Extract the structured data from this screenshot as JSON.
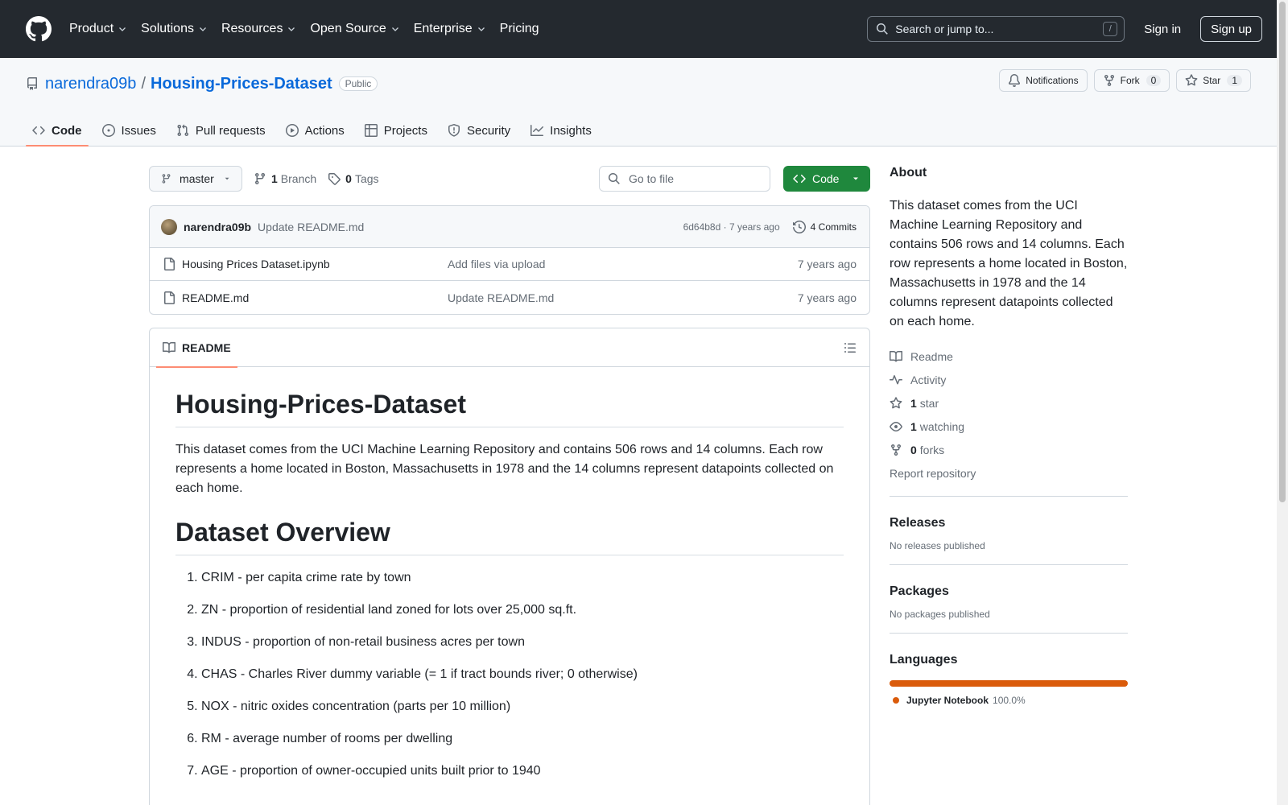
{
  "header": {
    "nav": [
      "Product",
      "Solutions",
      "Resources",
      "Open Source",
      "Enterprise",
      "Pricing"
    ],
    "search_placeholder": "Search or jump to...",
    "search_shortcut": "/",
    "sign_in": "Sign in",
    "sign_up": "Sign up"
  },
  "repo": {
    "owner": "narendra09b",
    "separator": "/",
    "name": "Housing-Prices-Dataset",
    "visibility": "Public",
    "notifications": "Notifications",
    "fork_label": "Fork",
    "fork_count": "0",
    "star_label": "Star",
    "star_count": "1",
    "tabs": [
      "Code",
      "Issues",
      "Pull requests",
      "Actions",
      "Projects",
      "Security",
      "Insights"
    ]
  },
  "filenav": {
    "branch": "master",
    "branch_count": "1",
    "branch_label": "Branch",
    "tag_count": "0",
    "tag_label": "Tags",
    "goto_placeholder": "Go to file",
    "code_button": "Code"
  },
  "commit": {
    "author": "narendra09b",
    "message": "Update README.md",
    "meta": "6d64b8d · 7 years ago",
    "count": "4 Commits"
  },
  "files": [
    {
      "name": "Housing Prices Dataset.ipynb",
      "message": "Add files via upload",
      "date": "7 years ago"
    },
    {
      "name": "README.md",
      "message": "Update README.md",
      "date": "7 years ago"
    }
  ],
  "readme": {
    "tab": "README",
    "title": "Housing-Prices-Dataset",
    "intro": "This dataset comes from the UCI Machine Learning Repository and contains 506 rows and 14 columns. Each row represents a home located in Boston, Massachusetts in 1978 and the 14 columns represent datapoints collected on each home.",
    "overview_title": "Dataset Overview",
    "items": [
      "CRIM - per capita crime rate by town",
      "ZN - proportion of residential land zoned for lots over 25,000 sq.ft.",
      "INDUS - proportion of non-retail business acres per town",
      "CHAS - Charles River dummy variable (= 1 if tract bounds river; 0 otherwise)",
      "NOX - nitric oxides concentration (parts per 10 million)",
      "RM - average number of rooms per dwelling",
      "AGE - proportion of owner-occupied units built prior to 1940"
    ]
  },
  "about": {
    "title": "About",
    "text": "This dataset comes from the UCI Machine Learning Repository and contains 506 rows and 14 columns. Each row represents a home located in Boston, Massachusetts in 1978 and the 14 columns represent datapoints collected on each home.",
    "readme": "Readme",
    "activity": "Activity",
    "stars_count": "1",
    "stars_label": "star",
    "watching_count": "1",
    "watching_label": "watching",
    "forks_count": "0",
    "forks_label": "forks",
    "report": "Report repository"
  },
  "releases": {
    "title": "Releases",
    "empty": "No releases published"
  },
  "packages": {
    "title": "Packages",
    "empty": "No packages published"
  },
  "languages": {
    "title": "Languages",
    "items": [
      {
        "name": "Jupyter Notebook",
        "percent": "100.0%",
        "fraction": 1.0,
        "color": "#DA5B0B"
      }
    ]
  },
  "colors": {
    "header_bg": "#24292f",
    "link": "#0969da",
    "primary_green": "#1f883d",
    "tab_underline": "#fd8c73"
  }
}
